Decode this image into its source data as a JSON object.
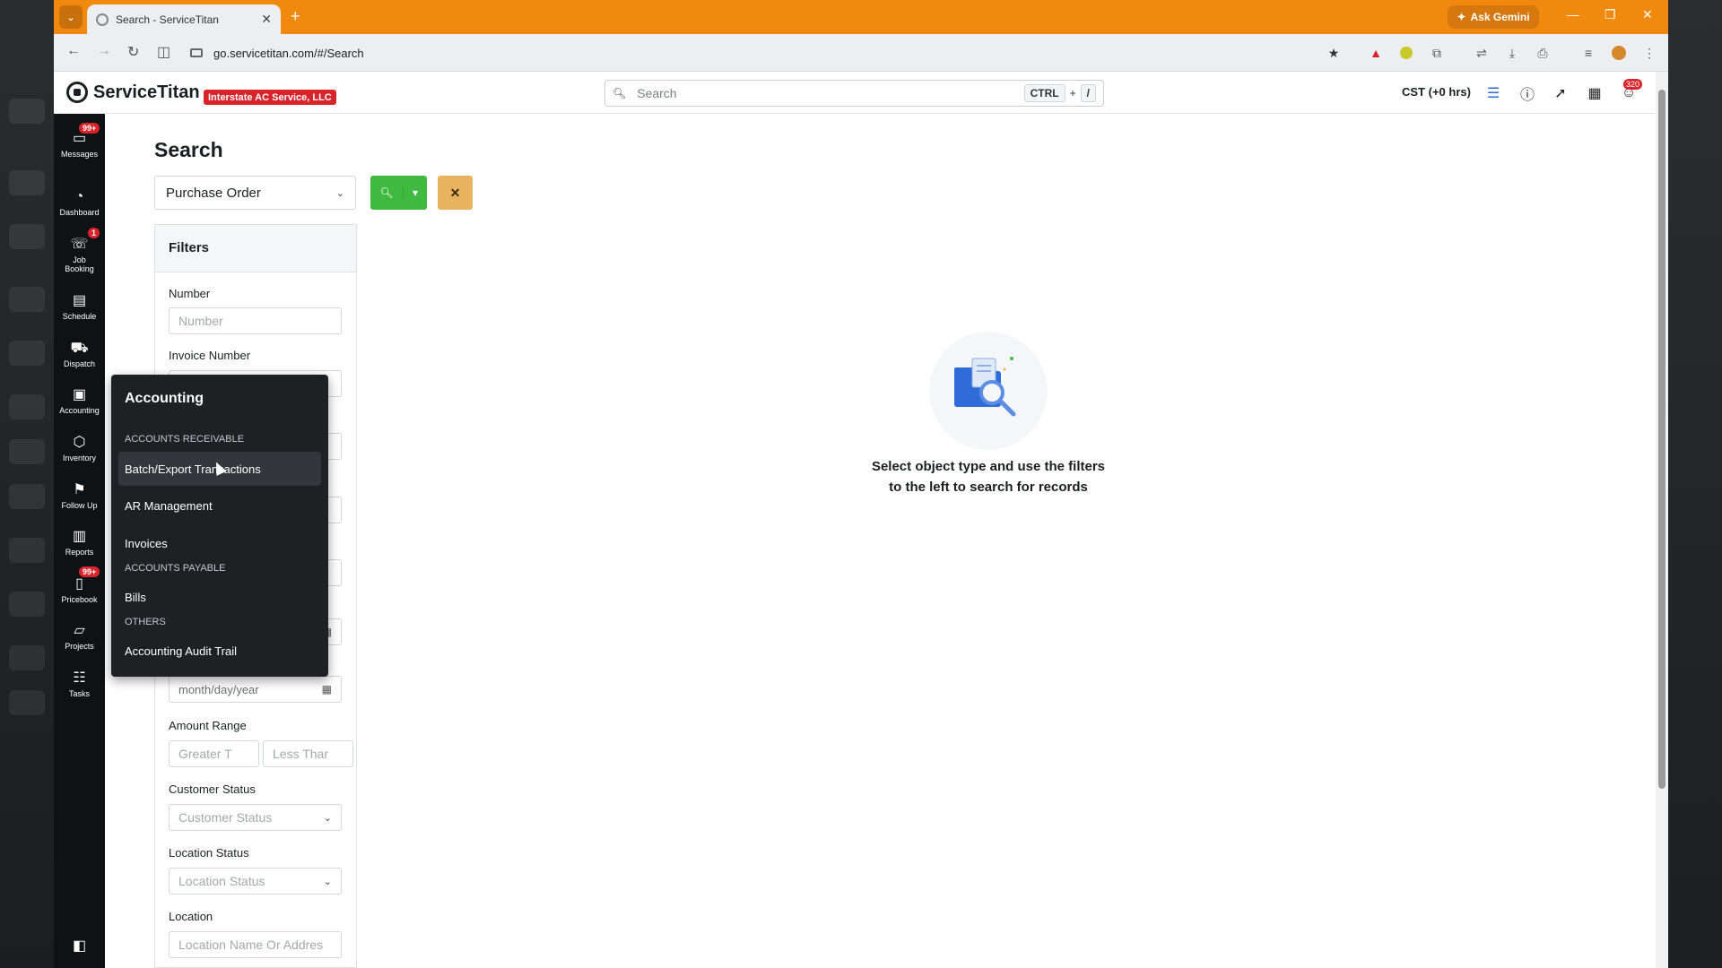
{
  "browser": {
    "tab_title": "Search - ServiceTitan",
    "url": "go.servicetitan.com/#/Search",
    "gemini_label": "Ask Gemini"
  },
  "header": {
    "brand": "ServiceTitan",
    "company": "Interstate AC Service, LLC",
    "search_placeholder": "Search",
    "shortcut_key1": "CTRL",
    "shortcut_plus": "+",
    "shortcut_key2": "/",
    "timezone": "CST (+0 hrs)",
    "notification_count": "320"
  },
  "nav": {
    "items": [
      {
        "label": "Messages",
        "icon": "message-icon",
        "badge": "99+"
      },
      {
        "label": "Dashboard",
        "icon": "dashboard-icon",
        "badge": ""
      },
      {
        "label": "Job Booking",
        "icon": "phone-icon",
        "badge": "1"
      },
      {
        "label": "Schedule",
        "icon": "calendar-icon",
        "badge": ""
      },
      {
        "label": "Dispatch",
        "icon": "truck-icon",
        "badge": ""
      },
      {
        "label": "Accounting",
        "icon": "clipboard-icon",
        "badge": ""
      },
      {
        "label": "Inventory",
        "icon": "box-icon",
        "badge": ""
      },
      {
        "label": "Follow Up",
        "icon": "flag-icon",
        "badge": ""
      },
      {
        "label": "Reports",
        "icon": "chart-icon",
        "badge": ""
      },
      {
        "label": "Pricebook",
        "icon": "book-icon",
        "badge": "99+"
      },
      {
        "label": "Projects",
        "icon": "folder-icon",
        "badge": ""
      },
      {
        "label": "Tasks",
        "icon": "tasks-icon",
        "badge": ""
      }
    ]
  },
  "page": {
    "title": "Search",
    "object_type": "Purchase Order",
    "filters_title": "Filters",
    "fields": {
      "number_label": "Number",
      "number_placeholder": "Number",
      "invoice_label": "Invoice Number",
      "date_placeholder": "month/day/year",
      "amount_label": "Amount Range",
      "amount_min_placeholder": "Greater T",
      "amount_max_placeholder": "Less Thar",
      "customer_status_label": "Customer Status",
      "customer_status_placeholder": "Customer Status",
      "location_status_label": "Location Status",
      "location_status_placeholder": "Location Status",
      "location_label": "Location",
      "location_placeholder": "Location Name Or Addres"
    },
    "empty_line1": "Select object type and use the filters",
    "empty_line2": "to the left to search for records"
  },
  "flyout": {
    "title": "Accounting",
    "section_receivable": "ACCOUNTS RECEIVABLE",
    "item_batch": "Batch/Export Transactions",
    "item_ar": "AR Management",
    "item_invoices": "Invoices",
    "section_payable": "ACCOUNTS PAYABLE",
    "item_bills": "Bills",
    "section_others": "OTHERS",
    "item_audit": "Accounting Audit Trail"
  },
  "colors": {
    "tabbar": "#f2890f",
    "brand_red": "#d8242b",
    "search_green": "#3fb93f",
    "clear_orange": "#e8b25e",
    "nav_bg": "#0f1215"
  }
}
